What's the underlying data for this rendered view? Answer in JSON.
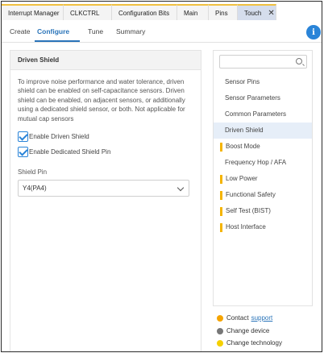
{
  "tabs": [
    {
      "label": "Interrupt Manager"
    },
    {
      "label": "CLKCTRL"
    },
    {
      "label": "Configuration Bits"
    },
    {
      "label": "Main"
    },
    {
      "label": "Pins"
    },
    {
      "label": "Touch",
      "active": true
    }
  ],
  "subtabs": {
    "create": "Create",
    "configure": "Configure",
    "tune": "Tune",
    "summary": "Summary"
  },
  "panel": {
    "title": "Driven Shield",
    "description": "To improve noise performance and water tolerance, driven shield can be enabled on self-capacitance sensors. Driven shield can be enabled, on adjacent sensors, or additionally using a dedicated shield sensor, or both. Not applicable for mutual cap sensors",
    "enable_driven_shield": "Enable Driven Shield",
    "enable_dedicated_pin": "Enable Dedicated Shield Pin",
    "shield_pin_label": "Shield Pin",
    "shield_pin_value": "Y4(PA4)"
  },
  "sidebar": {
    "search_value": "",
    "items": [
      {
        "label": "Sensor Pins",
        "marked": false
      },
      {
        "label": "Sensor Parameters",
        "marked": false
      },
      {
        "label": "Common Parameters",
        "marked": false
      },
      {
        "label": "Driven Shield",
        "marked": false,
        "selected": true
      },
      {
        "label": "Boost Mode",
        "marked": true
      },
      {
        "label": "Frequency Hop / AFA",
        "marked": false
      },
      {
        "label": "Low Power",
        "marked": true
      },
      {
        "label": "Functional Safety",
        "marked": true
      },
      {
        "label": "Self Test (BIST)",
        "marked": true
      },
      {
        "label": "Host Interface",
        "marked": true
      }
    ]
  },
  "legend": {
    "contact": "Contact",
    "support": "support",
    "change_device": "Change device",
    "change_technology": "Change technology"
  },
  "colors": {
    "accent": "#2a74b9",
    "mark": "#f5b400",
    "contact_dot": "#f5a400",
    "device_dot": "#777777",
    "technology_dot": "#f5d000"
  }
}
